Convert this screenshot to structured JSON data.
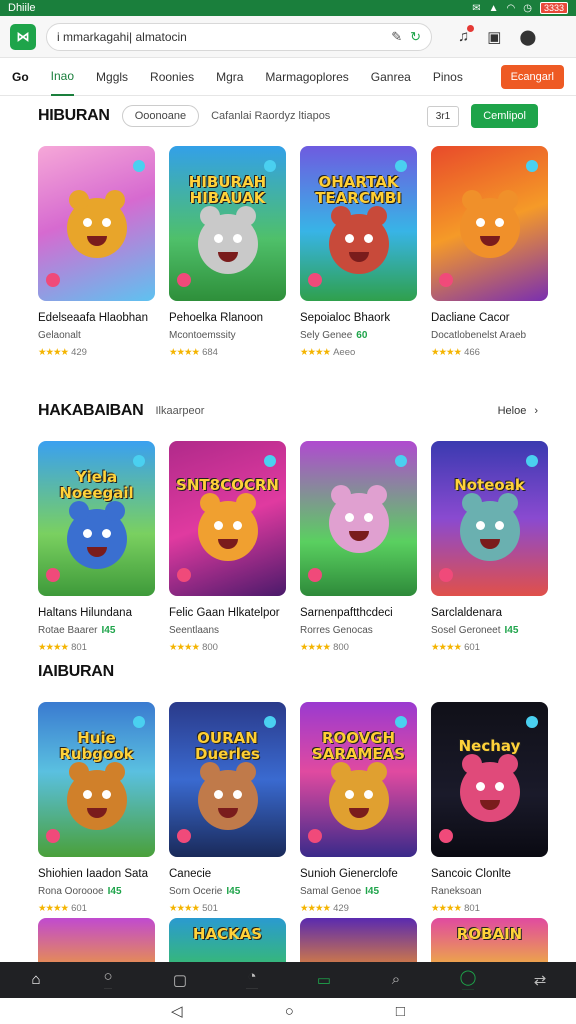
{
  "status": {
    "left": "Dhiile",
    "time_icon": "✉",
    "battery": "3333"
  },
  "urlbar": {
    "url": "i mmarkagahi| almatocin"
  },
  "nav": {
    "tabs": [
      "Go",
      "Inao",
      "Mggls",
      "Roonies",
      "Mgra",
      "Marmagoplores",
      "Ganrea",
      "Pinos"
    ],
    "cta": "Ecangarl"
  },
  "sections": [
    {
      "title": "HIBURAN",
      "pill": "Ooonoane",
      "sub": "Cafanlai  Raordyz  ltiapos",
      "small_box": "3r1",
      "button": "Cemlipol",
      "cards": [
        {
          "thumb_text": "",
          "title": "Edelseaafa Hlaobhan",
          "sub": "Gelaonalt",
          "sub_tag": "",
          "rating": "429",
          "bg": "linear-gradient(160deg,#f6a8d8,#d66ad0 45%,#5ec2f0)",
          "mascot": "#e8a52a",
          "thumb_color": "#ffd23a"
        },
        {
          "thumb_text": "HIBURAH HIBAUAK",
          "title": "Pehoelka Rlanoon",
          "sub": "Mcontoemssity",
          "sub_tag": "",
          "rating": "684",
          "bg": "linear-gradient(180deg,#33a0e8,#4fc06a 60%,#2e8f3a)",
          "mascot": "#c9c9c9",
          "thumb_color": "#ffd23a"
        },
        {
          "thumb_text": "OHARTAK TEARCMBI",
          "title": "Sepoialoc Bhaork",
          "sub": "Sely Genee",
          "sub_tag": "60",
          "rating": "Aeeo",
          "bg": "linear-gradient(180deg,#6e5be0,#38b4e6 55%,#2fa04c)",
          "mascot": "#c84a3a",
          "thumb_color": "#ffcf33"
        },
        {
          "thumb_text": "",
          "title": "Dacliane Cacor",
          "sub": "Docatlobenelst Araeb",
          "sub_tag": "",
          "rating": "466",
          "bg": "linear-gradient(160deg,#e84a2a,#f59a28 50%,#7a2fb0)",
          "mascot": "#f0902a",
          "thumb_color": "#ffd23a"
        }
      ]
    },
    {
      "title": "HAKABAIBAN",
      "sub": "Ilkaarpeor",
      "more": "Heloe",
      "cards": [
        {
          "thumb_text": "Yiela Noeegail",
          "title": "Haltans Hilundana",
          "sub": "Rotae Baarer",
          "sub_tag": "I45",
          "rating": "801",
          "bg": "linear-gradient(180deg,#3aa0f0,#7ad060 60%,#3e9a3a)",
          "mascot": "#3a6fd0",
          "thumb_color": "#ffd23a"
        },
        {
          "thumb_text": "SNT8COCRN",
          "title": "Felic Gaan Hlkatelpor",
          "sub": "Seentlaans",
          "sub_tag": "",
          "rating": "800",
          "bg": "linear-gradient(160deg,#b02a8a,#e03aa0 50%,#4a1a6a)",
          "mascot": "#f0a030",
          "thumb_color": "#ffd23a"
        },
        {
          "thumb_text": "",
          "title": "Sarnenpaftthcdeci",
          "sub": "Rorres Genocas",
          "sub_tag": "",
          "rating": "800",
          "bg": "linear-gradient(180deg,#b04ad0,#5ad060 65%,#2e8a3a)",
          "mascot": "#e0a0d0",
          "thumb_color": "#ffd23a"
        },
        {
          "thumb_text": "Noteoak",
          "title": "Sarclaldenara",
          "sub": "Sosel Geroneet",
          "sub_tag": "I45",
          "rating": "601",
          "bg": "linear-gradient(180deg,#3a3ab0,#8a4ad0 50%,#e0504a)",
          "mascot": "#6ab0b0",
          "thumb_color": "#ffd23a"
        }
      ]
    },
    {
      "title": "IAIBURAN",
      "cards": [
        {
          "thumb_text": "Huie Rubgook",
          "title": "Shiohien Iaadon Sata",
          "sub": "Rona Ooroooe",
          "sub_tag": "I45",
          "rating": "601",
          "bg": "linear-gradient(180deg,#3a7ad0,#5ac0e0 45%,#4aa03a)",
          "mascot": "#d0802a",
          "thumb_color": "#ffd23a"
        },
        {
          "thumb_text": "OURAN Duerles",
          "title": "Canecie",
          "sub": "Sorn Ocerie",
          "sub_tag": "I45",
          "rating": "501",
          "bg": "linear-gradient(180deg,#2a3a8a,#3a6ad0 50%,#1a2a5a)",
          "mascot": "#c07a4a",
          "thumb_color": "#ffcf33"
        },
        {
          "thumb_text": "ROOVGH SARAMEAS",
          "title": "Sunioh Gienerclofe",
          "sub": "Samal Genoe",
          "sub_tag": "I45",
          "rating": "429",
          "bg": "linear-gradient(180deg,#9a3ad0,#e04aa0 45%,#3a2a8a)",
          "mascot": "#e0a030",
          "thumb_color": "#ffcf33"
        },
        {
          "thumb_text": "Nechay",
          "title": "Sancoic Clonlte",
          "sub": "Raneksoan",
          "sub_tag": "",
          "rating": "801",
          "bg": "linear-gradient(180deg,#101018,#1a1a2a 60%,#0a0a12)",
          "mascot": "#e04a7a",
          "thumb_color": "#ffd23a"
        }
      ]
    }
  ],
  "peek": [
    {
      "thumb_text": "",
      "bg": "linear-gradient(180deg,#c04ad0,#f0a030)"
    },
    {
      "thumb_text": "HACKAS",
      "bg": "linear-gradient(180deg,#2a9ad0,#3ac060)"
    },
    {
      "thumb_text": "",
      "bg": "linear-gradient(180deg,#5a2ab0,#f0902a)"
    },
    {
      "thumb_text": "ROBAIN",
      "bg": "linear-gradient(180deg,#e04aa0,#f0c030)"
    }
  ],
  "appnav": [
    {
      "icon": "⌂",
      "label": ""
    },
    {
      "icon": "○",
      "label": "····"
    },
    {
      "icon": "▢",
      "label": ""
    },
    {
      "icon": "◔",
      "label": "······"
    },
    {
      "icon": "▭",
      "label": ""
    },
    {
      "icon": "⌕",
      "label": ""
    },
    {
      "icon": "◯",
      "label": "······"
    },
    {
      "icon": "⇄",
      "label": ""
    }
  ],
  "icons": {
    "accent": "#1ea44a",
    "cta": "#ee5a24"
  }
}
